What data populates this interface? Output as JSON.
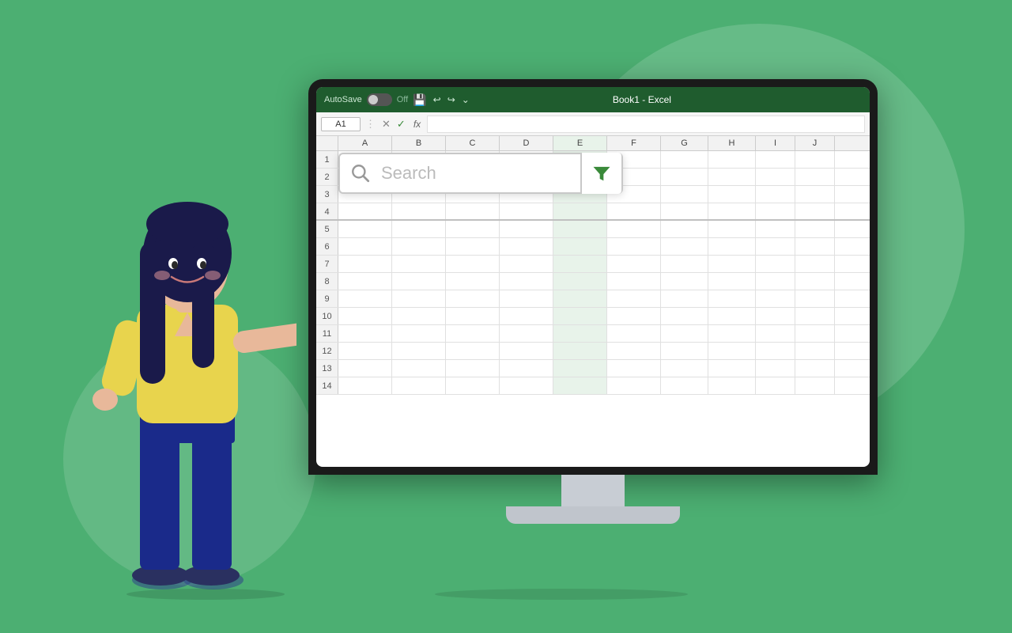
{
  "background": {
    "color": "#4caf72"
  },
  "titlebar": {
    "autosave_label": "AutoSave",
    "toggle_state": "Off",
    "title": "Book1 - Excel",
    "icons": [
      "save",
      "undo",
      "redo",
      "more"
    ]
  },
  "formula_bar": {
    "cell_ref": "A1",
    "fx_label": "fx"
  },
  "columns": [
    "A",
    "B",
    "C",
    "D",
    "E",
    "F",
    "G",
    "H",
    "I",
    "J"
  ],
  "rows": [
    1,
    2,
    3,
    4,
    5,
    6,
    7,
    8,
    9,
    10,
    11,
    12,
    13,
    14
  ],
  "search": {
    "placeholder": "Search",
    "search_icon": "🔍",
    "filter_icon": "▼"
  }
}
